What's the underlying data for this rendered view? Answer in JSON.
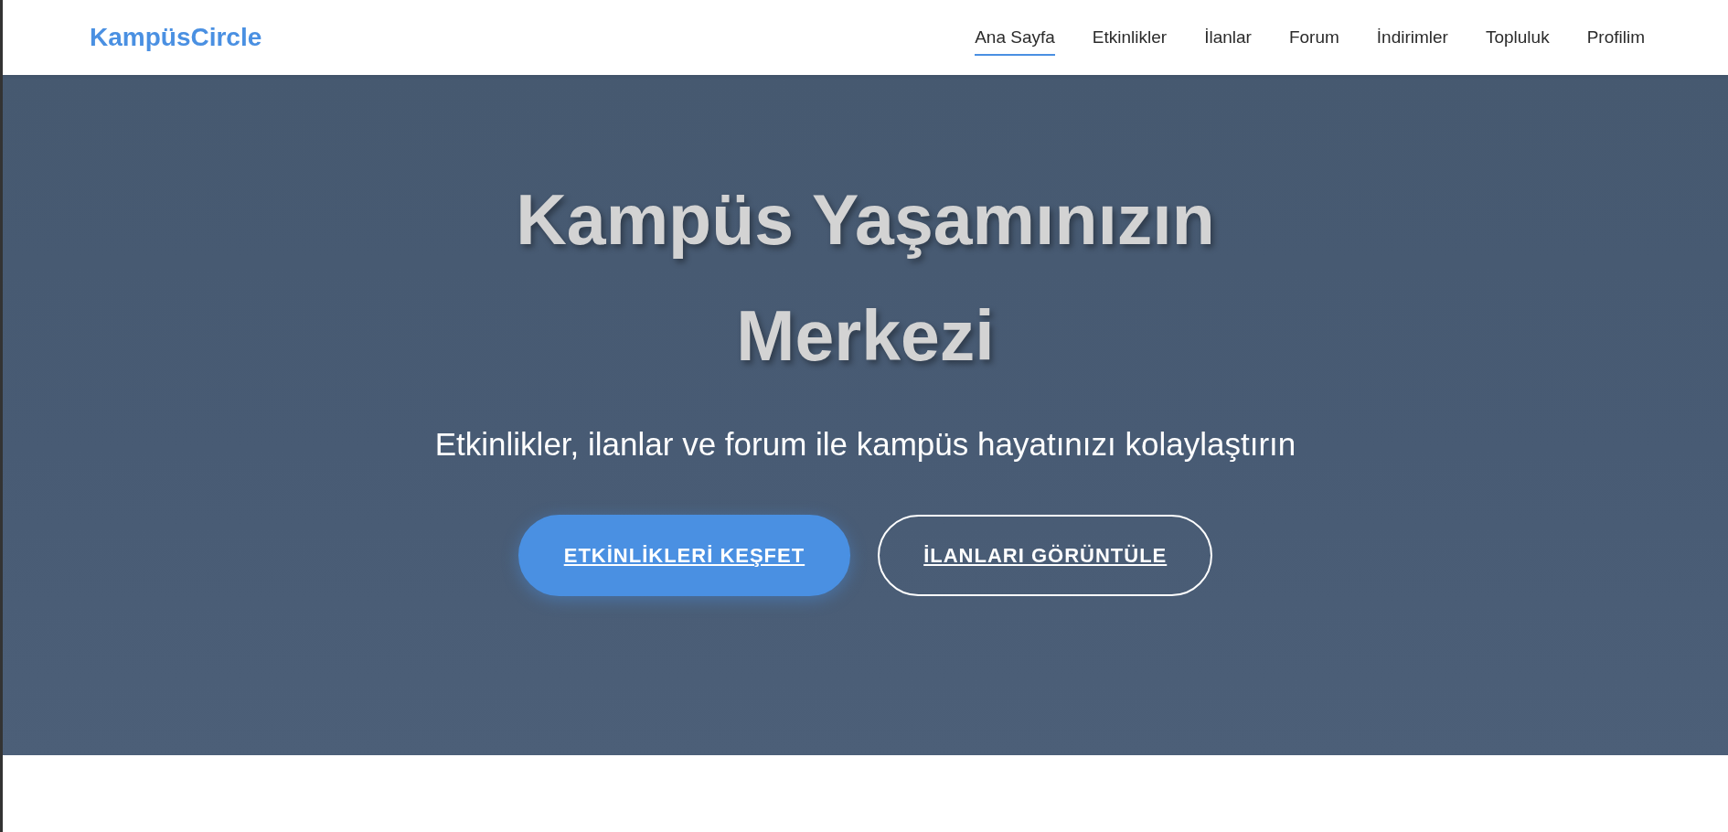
{
  "header": {
    "logo": "KampüsCircle",
    "nav": [
      {
        "label": "Ana Sayfa",
        "selected": true
      },
      {
        "label": "Etkinlikler",
        "selected": false
      },
      {
        "label": "İlanlar",
        "selected": false
      },
      {
        "label": "Forum",
        "selected": false
      },
      {
        "label": "İndirimler",
        "selected": false
      },
      {
        "label": "Topluluk",
        "selected": false
      },
      {
        "label": "Profilim",
        "selected": false
      }
    ]
  },
  "hero": {
    "title": "Kampüs Yaşamınızın Merkezi",
    "subtitle": "Etkinlikler, ilanlar ve forum ile kampüs hayatınızı kolaylaştırın",
    "buttons": [
      {
        "label": "ETKİNLİKLERİ KEŞFET",
        "kind": "primary"
      },
      {
        "label": "İLANLARI GÖRÜNTÜLE",
        "kind": "outline"
      }
    ]
  }
}
